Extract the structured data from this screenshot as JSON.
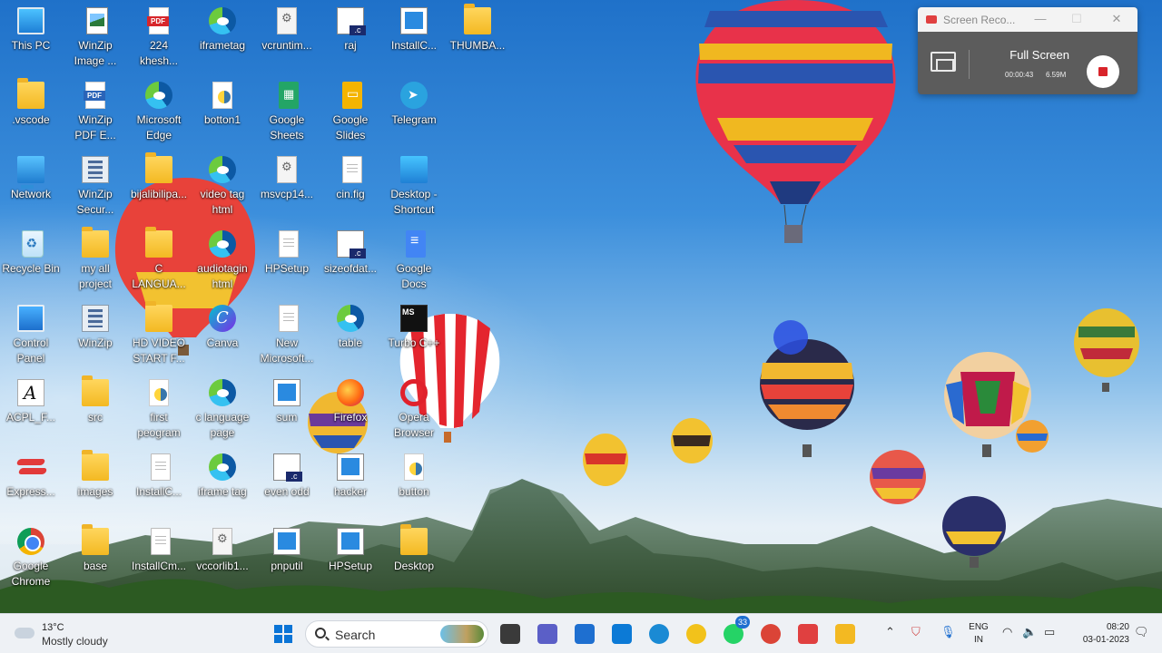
{
  "desktop": {
    "icons": [
      {
        "label": "This PC",
        "icon": "this-pc-icon"
      },
      {
        "label": "WinZip\nImage ...",
        "icon": "winzip-image-icon"
      },
      {
        "label": "224\nkhesh...",
        "icon": "pdf-file-icon"
      },
      {
        "label": "iframetag",
        "icon": "edge-html-icon"
      },
      {
        "label": "vcruntim...",
        "icon": "settings-file-icon"
      },
      {
        "label": "raj",
        "icon": "c-file-icon"
      },
      {
        "label": "InstallC...",
        "icon": "installer-icon"
      },
      {
        "label": "THUMBA...",
        "icon": "folder-icon"
      },
      {
        "label": ".vscode",
        "icon": "folder-icon"
      },
      {
        "label": "WinZip\nPDF E...",
        "icon": "winzip-pdf-icon"
      },
      {
        "label": "Microsoft\nEdge",
        "icon": "edge-icon"
      },
      {
        "label": "botton1",
        "icon": "python-file-icon"
      },
      {
        "label": "Google\nSheets",
        "icon": "google-sheets-icon"
      },
      {
        "label": "Google\nSlides",
        "icon": "google-slides-icon"
      },
      {
        "label": "Telegram",
        "icon": "telegram-icon"
      },
      {
        "label": "Network",
        "icon": "network-icon"
      },
      {
        "label": "WinZip\nSecur...",
        "icon": "winzip-secure-icon"
      },
      {
        "label": "bijalibilipa...",
        "icon": "folder-icon"
      },
      {
        "label": "video tag\nhtml",
        "icon": "edge-html-icon"
      },
      {
        "label": "msvcp14...",
        "icon": "settings-file-icon"
      },
      {
        "label": "cin.fig",
        "icon": "document-icon"
      },
      {
        "label": "Desktop -\nShortcut",
        "icon": "desktop-shortcut-icon"
      },
      {
        "label": "Recycle Bin",
        "icon": "recycle-bin-icon"
      },
      {
        "label": "my all\nproject",
        "icon": "folder-icon"
      },
      {
        "label": "C\nLANGUA...",
        "icon": "folder-icon"
      },
      {
        "label": "audiotagin\nhtml",
        "icon": "edge-html-icon"
      },
      {
        "label": "HPSetup",
        "icon": "document-icon"
      },
      {
        "label": "sizeofdat...",
        "icon": "c-file-icon"
      },
      {
        "label": "Google\nDocs",
        "icon": "google-docs-icon"
      },
      {
        "label": "Control\nPanel",
        "icon": "control-panel-icon"
      },
      {
        "label": "WinZip",
        "icon": "winzip-icon"
      },
      {
        "label": "HD VIDEO\nSTART F...",
        "icon": "folder-icon"
      },
      {
        "label": "Canva",
        "icon": "canva-icon"
      },
      {
        "label": "New\nMicrosoft...",
        "icon": "document-icon"
      },
      {
        "label": "table",
        "icon": "edge-html-icon"
      },
      {
        "label": "Turbo C++",
        "icon": "turbo-cpp-icon"
      },
      {
        "label": "ACPL_F...",
        "icon": "acpl-icon"
      },
      {
        "label": "src",
        "icon": "folder-icon"
      },
      {
        "label": "first\npeogram",
        "icon": "python-file-icon"
      },
      {
        "label": "c language\npage",
        "icon": "edge-html-icon"
      },
      {
        "label": "sum",
        "icon": "installer-icon"
      },
      {
        "label": "Firefox",
        "icon": "firefox-icon"
      },
      {
        "label": "Opera\nBrowser",
        "icon": "opera-icon"
      },
      {
        "label": "Express...",
        "icon": "expressvpn-icon"
      },
      {
        "label": "images",
        "icon": "folder-icon"
      },
      {
        "label": "InstallC...",
        "icon": "document-icon"
      },
      {
        "label": "iframe tag",
        "icon": "edge-html-icon"
      },
      {
        "label": "even odd",
        "icon": "c-file-icon"
      },
      {
        "label": "hacker",
        "icon": "installer-icon"
      },
      {
        "label": "button",
        "icon": "python-file-icon"
      },
      {
        "label": "Google\nChrome",
        "icon": "chrome-icon"
      },
      {
        "label": "base",
        "icon": "folder-icon"
      },
      {
        "label": "InstallCm...",
        "icon": "document-icon"
      },
      {
        "label": "vccorlib1...",
        "icon": "settings-file-icon"
      },
      {
        "label": "pnputil",
        "icon": "installer-icon"
      },
      {
        "label": "HPSetup",
        "icon": "installer-icon"
      },
      {
        "label": "Desktop",
        "icon": "folder-icon"
      }
    ]
  },
  "recorder": {
    "title": "Screen Reco...",
    "mode": "Full Screen",
    "elapsed": "00:00:43",
    "file_size": "6.59M",
    "window_controls": [
      "—",
      "☐",
      "✕"
    ]
  },
  "taskbar": {
    "weather": {
      "temp": "13°C",
      "desc": "Mostly cloudy"
    },
    "search": {
      "label": "Search"
    },
    "apps": [
      {
        "name": "file-explorer-dark",
        "color": "#3a3a3a"
      },
      {
        "name": "teams-chat",
        "color": "#5b5fc7"
      },
      {
        "name": "microsoft-store",
        "color": "#1e6fd0"
      },
      {
        "name": "snipping-tool",
        "color": "#0c7ad6"
      },
      {
        "name": "edge",
        "color": "#1a8ad4"
      },
      {
        "name": "python-idle",
        "color": "#f2c21b"
      },
      {
        "name": "whatsapp",
        "color": "#25d366",
        "badge": "33"
      },
      {
        "name": "chrome",
        "color": "#db4437"
      },
      {
        "name": "screen-recorder",
        "color": "#e04040"
      },
      {
        "name": "file-explorer",
        "color": "#f3b922"
      }
    ],
    "language": {
      "line1": "ENG",
      "line2": "IN"
    },
    "clock": {
      "time": "08:20",
      "date": "03-01-2023"
    }
  },
  "colors": {
    "sky_top": "#1f71c9",
    "taskbar": "#eef1f5",
    "recorder_panel": "#5c5c5c",
    "stop_red": "#d8242a"
  }
}
